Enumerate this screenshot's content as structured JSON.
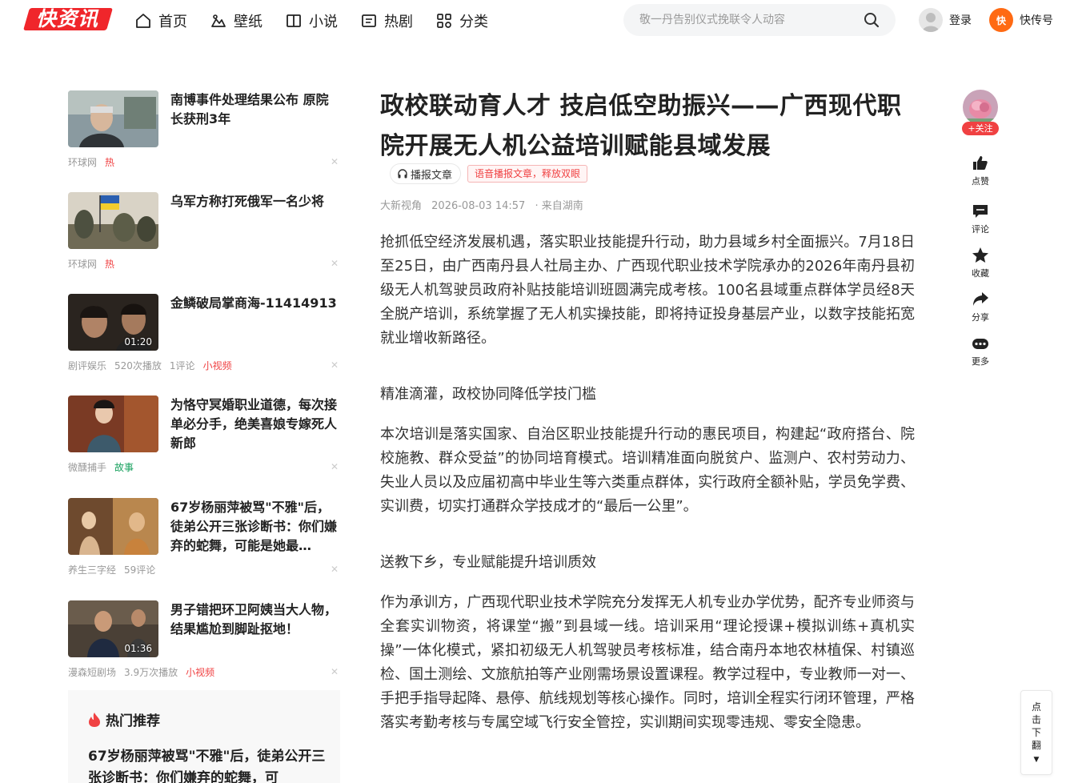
{
  "header": {
    "logo_text": "快资讯",
    "nav": [
      {
        "label": "首页",
        "icon": "home-icon"
      },
      {
        "label": "壁纸",
        "icon": "wallpaper-icon"
      },
      {
        "label": "小说",
        "icon": "book-icon"
      },
      {
        "label": "热剧",
        "icon": "tv-icon"
      },
      {
        "label": "分类",
        "icon": "grid-icon"
      }
    ],
    "search_placeholder": "敬一丹告别仪式挽联令人动容",
    "login_label": "登录",
    "kch_label": "快传号",
    "kch_logo": "快"
  },
  "feed": [
    {
      "title": "南博事件处理结果公布 原院长获刑3年",
      "meta": [
        "环球网"
      ],
      "tag": "热",
      "tag_type": "hot"
    },
    {
      "title": "乌军方称打死俄军一名少将",
      "meta": [
        "环球网"
      ],
      "tag": "热",
      "tag_type": "hot"
    },
    {
      "title": "金鳞破局掌商海-11414913",
      "meta": [
        "剧评娱乐",
        "520次播放",
        "1评论"
      ],
      "tag": "小视频",
      "tag_type": "hot",
      "duration": "01:20"
    },
    {
      "title": "为恪守冥婚职业道德，每次接单必分手，绝美喜娘专嫁死人新郎",
      "meta": [
        "微醺捕手"
      ],
      "tag": "故事",
      "tag_type": "green"
    },
    {
      "title": "67岁杨丽萍被骂\"不雅\"后，徒弟公开三张诊断书：你们嫌弃的蛇舞，可能是她最…",
      "meta": [
        "养生三字经",
        "59评论"
      ],
      "tag": "",
      "tag_type": ""
    },
    {
      "title": "男子错把环卫阿姨当大人物，结果尴尬到脚趾抠地！",
      "meta": [
        "漫森短剧场",
        "3.9万次播放"
      ],
      "tag": "小视频",
      "tag_type": "hot",
      "duration": "01:36"
    }
  ],
  "hot_panel": {
    "heading": "热门推荐",
    "first_title": "67岁杨丽萍被骂\"不雅\"后，徒弟公开三张诊断书：你们嫌弃的蛇舞，可"
  },
  "article": {
    "title": "政校联动育人才 技启低空助振兴——广西现代职院开展无人机公益培训赋能县域发展",
    "listen_label": "播报文章",
    "listen_tip": "语音播报文章，释放双眼",
    "source": "大新视角",
    "datetime": "2026-08-03 14:57",
    "origin": "· 来自湖南",
    "p1": "抢抓低空经济发展机遇，落实职业技能提升行动，助力县域乡村全面振兴。7月18日至25日，由广西南丹县人社局主办、广西现代职业技术学院承办的2026年南丹县初级无人机驾驶员政府补贴技能培训班圆满完成考核。100名县域重点群体学员经8天全脱产培训，系统掌握了无人机实操技能，即将持证投身基层产业，以数字技能拓宽就业增收新路径。",
    "h1": "精准滴灌，政校协同降低学技门槛",
    "p2": "本次培训是落实国家、自治区职业技能提升行动的惠民项目，构建起“政府搭台、院校施教、群众受益”的协同培育模式。培训精准面向脱贫户、监测户、农村劳动力、失业人员以及应届初高中毕业生等六类重点群体，实行政府全额补贴，学员免学费、实训费，切实打通群众学技成才的“最后一公里”。",
    "h2": "送教下乡，专业赋能提升培训质效",
    "p3": "作为承训方，广西现代职业技术学院充分发挥无人机专业办学优势，配齐专业师资与全套实训物资，将课堂“搬”到县域一线。培训采用“理论授课+模拟训练+真机实操”一体化模式，紧扣初级无人机驾驶员考核标准，结合南丹本地农林植保、村镇巡检、国土测绘、文旅航拍等产业刚需场景设置课程。教学过程中，专业教师一对一、手把手指导起降、悬停、航线规划等核心操作。同时，培训全程实行闭环管理，严格落实考勤考核与专属空域飞行安全管控，实训期间实现零违规、零安全隐患。"
  },
  "actions": {
    "follow": "+关注",
    "like": "点赞",
    "comment": "评论",
    "collect": "收藏",
    "share": "分享",
    "more": "更多"
  },
  "next_page": "点击下翻",
  "colors": {
    "brand_red": "#f0262b",
    "hot_red": "#f04142",
    "kch_orange": "#ff6a13",
    "tag_green": "#19a15f"
  }
}
